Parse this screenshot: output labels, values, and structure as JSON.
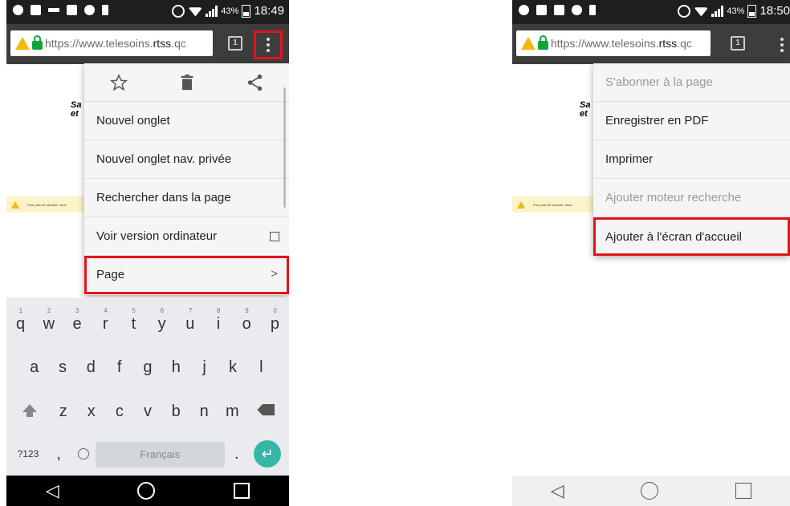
{
  "left": {
    "status": {
      "battery": "43%",
      "time": "18:49"
    },
    "url": {
      "prefix": "https://www.telesoins.",
      "bold": "rtss",
      "suffix": ".qc"
    },
    "tab_count": "1",
    "page_fragment": {
      "line1": "Sa",
      "line2": "et"
    },
    "page_warning": "Pour plus de sécurité, nous",
    "menu": {
      "items": [
        {
          "label": "Nouvel onglet"
        },
        {
          "label": "Nouvel onglet nav. privée"
        },
        {
          "label": "Rechercher dans la page"
        },
        {
          "label": "Voir version ordinateur"
        },
        {
          "label": "Page"
        }
      ]
    },
    "keyboard": {
      "row1": [
        "q",
        "w",
        "e",
        "r",
        "t",
        "y",
        "u",
        "i",
        "o",
        "p"
      ],
      "row1_hints": [
        "1",
        "2",
        "3",
        "4",
        "5",
        "6",
        "7",
        "8",
        "9",
        "0"
      ],
      "row2": [
        "a",
        "s",
        "d",
        "f",
        "g",
        "h",
        "j",
        "k",
        "l"
      ],
      "row3": [
        "z",
        "x",
        "c",
        "v",
        "b",
        "n",
        "m"
      ],
      "symbols": "?123",
      "comma": ",",
      "space": "Français",
      "period": "."
    }
  },
  "right": {
    "status": {
      "battery": "43%",
      "time": "18:50"
    },
    "url": {
      "prefix": "https://www.telesoins.",
      "bold": "rtss",
      "suffix": ".qc"
    },
    "tab_count": "1",
    "page_fragment": {
      "line1": "Sa",
      "line2": "et"
    },
    "page_warning": "Pour plus de sécurité, nous",
    "menu": {
      "items": [
        {
          "label": "S'abonner à la page"
        },
        {
          "label": "Enregistrer en PDF"
        },
        {
          "label": "Imprimer"
        },
        {
          "label": "Ajouter moteur recherche"
        },
        {
          "label": "Ajouter à l'écran d'accueil"
        }
      ]
    }
  }
}
